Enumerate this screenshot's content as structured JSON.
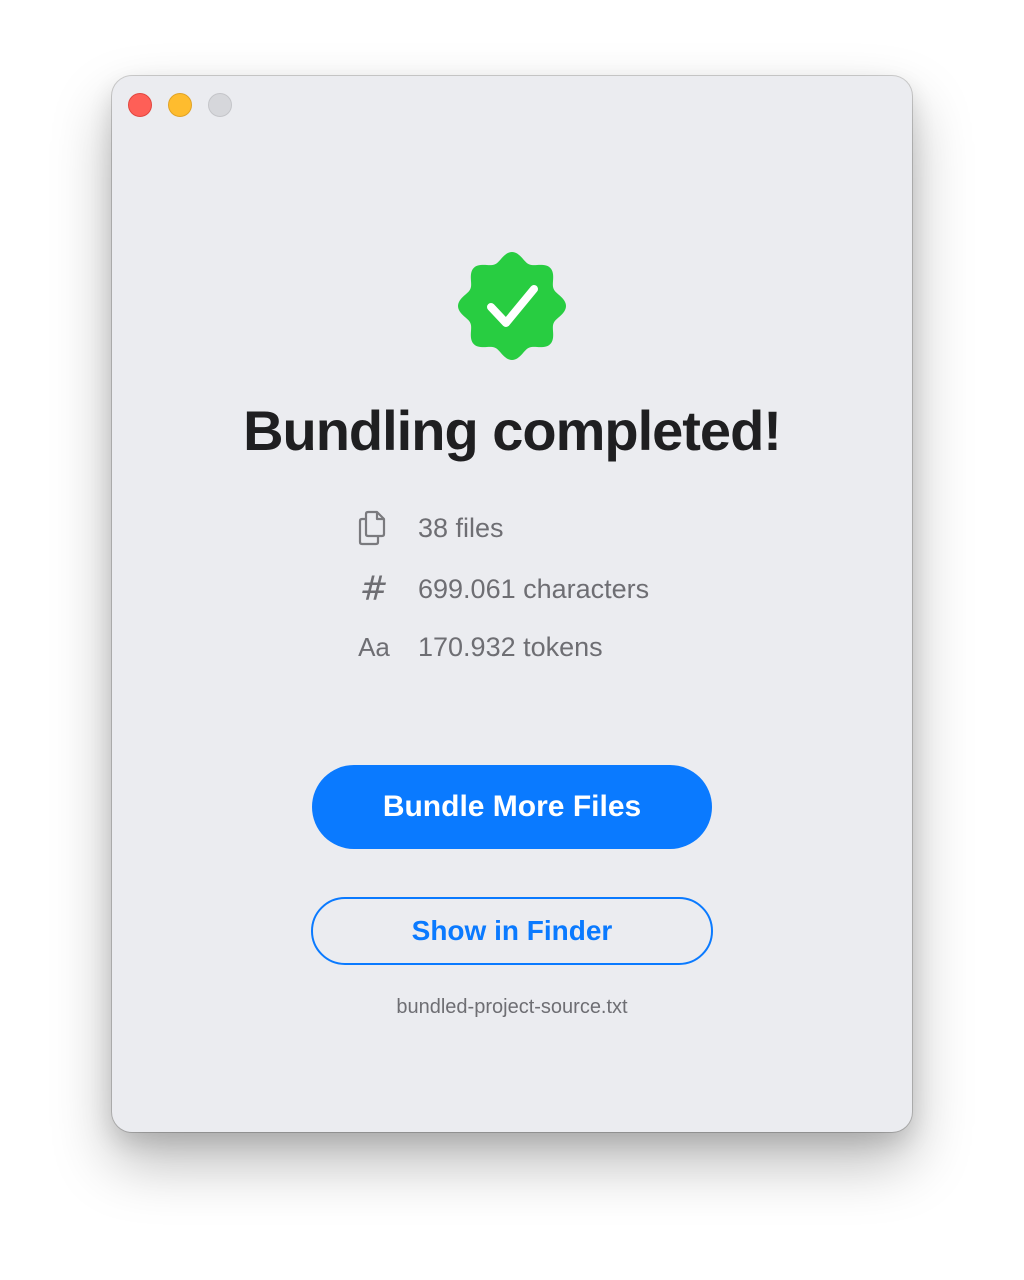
{
  "window": {
    "controls": [
      "close",
      "minimize",
      "zoom"
    ]
  },
  "status": {
    "icon": "checkmark-seal-icon",
    "icon_color": "#28cd41",
    "title": "Bundling completed!"
  },
  "stats": [
    {
      "icon": "documents-icon",
      "text": "38 files"
    },
    {
      "icon": "number-sign-icon",
      "glyph": "#",
      "text": "699.061 characters"
    },
    {
      "icon": "text-format-icon",
      "glyph": "Aa",
      "text": "170.932 tokens"
    }
  ],
  "actions": {
    "primary_label": "Bundle More Files",
    "secondary_label": "Show in Finder",
    "accent_color": "#0a7aff"
  },
  "output": {
    "filename": "bundled-project-source.txt"
  }
}
